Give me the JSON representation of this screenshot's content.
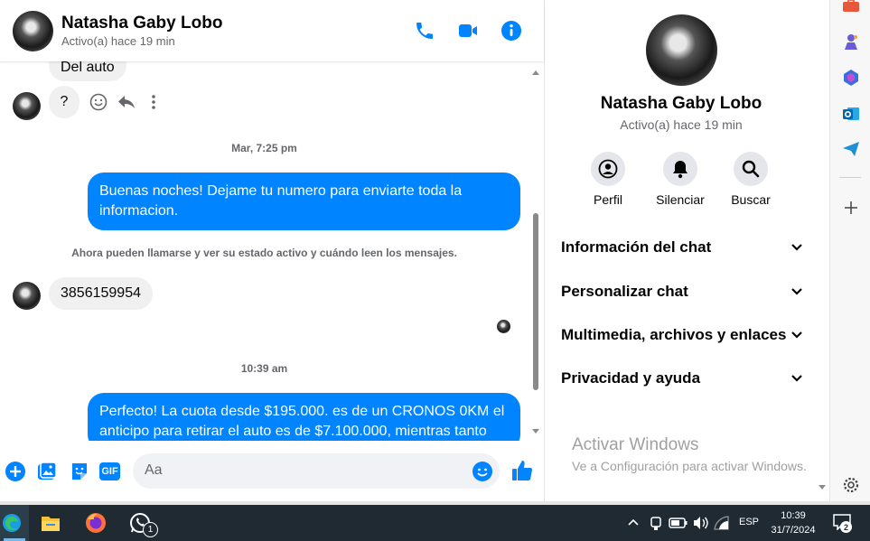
{
  "header": {
    "name": "Natasha Gaby Lobo",
    "status": "Activo(a) hace 19 min"
  },
  "messages": {
    "partial_in": "Del auto",
    "question_in": "?",
    "time1": "Mar, 7:25 pm",
    "out1": "Buenas noches! Dejame tu numero para enviarte toda la informacion.",
    "system": "Ahora pueden llamarse y ver su estado activo y cuándo leen los mensajes.",
    "phone_in": "3856159954",
    "time2": "10:39 am",
    "out2": "Perfecto! La cuota desde $195.000. es de un CRONOS 0KM el anticipo para retirar el auto es de $7.100.000, mientras tanto"
  },
  "composer": {
    "placeholder": "Aa",
    "gif_label": "GIF"
  },
  "panel": {
    "name": "Natasha Gaby Lobo",
    "status": "Activo(a) hace 19 min",
    "actions": [
      {
        "label": "Perfil",
        "icon": "profile-icon"
      },
      {
        "label": "Silenciar",
        "icon": "bell-icon"
      },
      {
        "label": "Buscar",
        "icon": "search-icon"
      }
    ],
    "sections": [
      "Información del chat",
      "Personalizar chat",
      "Multimedia, archivos y enlaces",
      "Privacidad y ayuda"
    ]
  },
  "watermark": {
    "line1": "Activar Windows",
    "line2": "Ve a Configuración para activar Windows."
  },
  "taskbar": {
    "whatsapp_badge": "1",
    "language": "ESP",
    "time": "10:39",
    "date": "31/7/2024",
    "notifications": "2"
  },
  "colors": {
    "accent": "#0084ff",
    "bubble_in": "#f0f0f0",
    "muted_text": "#65676b",
    "taskbar": "#1f2a33"
  }
}
